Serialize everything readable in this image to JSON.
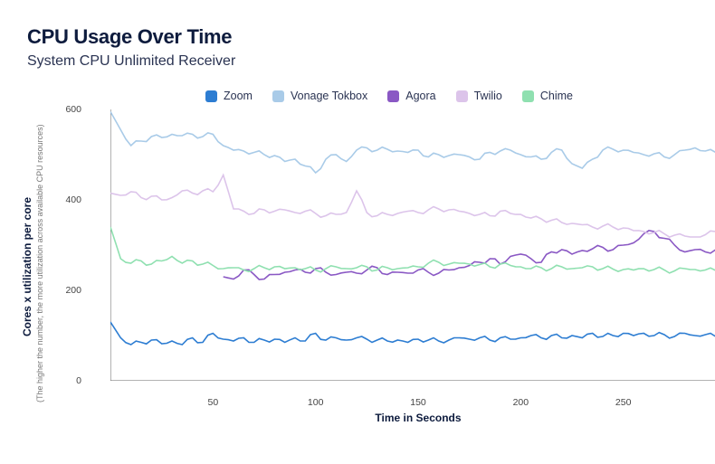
{
  "title": "CPU Usage Over Time",
  "subtitle": "System CPU Unlimited Receiver",
  "xlabel": "Time in Seconds",
  "ylabel": "Cores x utilization per core",
  "ylabel_sub": "(The higher the number, the more utilization across available CPU resources)",
  "legend": [
    {
      "name": "Zoom",
      "color": "#2d7dd2"
    },
    {
      "name": "Vonage Tokbox",
      "color": "#a9cbe8"
    },
    {
      "name": "Agora",
      "color": "#8a58c4"
    },
    {
      "name": "Twilio",
      "color": "#dcc4ea"
    },
    {
      "name": "Chime",
      "color": "#8fe0b0"
    }
  ],
  "chart_data": {
    "type": "line",
    "xlabel": "Time in Seconds",
    "ylabel": "Cores x utilization per core",
    "title": "CPU Usage Over Time — System CPU Unlimited Receiver",
    "xlim": [
      0,
      300
    ],
    "ylim": [
      0,
      600
    ],
    "xticks": [
      50,
      100,
      150,
      200,
      250,
      300
    ],
    "yticks": [
      0,
      200,
      400,
      600
    ],
    "x": [
      0,
      5,
      10,
      15,
      20,
      25,
      30,
      35,
      40,
      45,
      50,
      55,
      60,
      65,
      70,
      75,
      80,
      85,
      90,
      95,
      100,
      105,
      110,
      115,
      120,
      125,
      130,
      135,
      140,
      145,
      150,
      155,
      160,
      165,
      170,
      175,
      180,
      185,
      190,
      195,
      200,
      205,
      210,
      215,
      220,
      225,
      230,
      235,
      240,
      245,
      250,
      255,
      260,
      265,
      270,
      275,
      280,
      285,
      290,
      295,
      300
    ],
    "series": [
      {
        "name": "Zoom",
        "color": "#2d7dd2",
        "values": [
          130,
          95,
          80,
          85,
          90,
          82,
          88,
          80,
          95,
          85,
          105,
          92,
          88,
          95,
          85,
          90,
          92,
          85,
          95,
          88,
          105,
          90,
          95,
          90,
          95,
          92,
          90,
          88,
          90,
          85,
          92,
          90,
          88,
          90,
          95,
          92,
          95,
          90,
          95,
          92,
          95,
          100,
          95,
          100,
          95,
          100,
          95,
          105,
          98,
          100,
          105,
          100,
          105,
          100,
          102,
          98,
          105,
          100,
          102,
          98,
          105
        ]
      },
      {
        "name": "Vonage Tokbox",
        "color": "#a9cbe8",
        "values": [
          595,
          555,
          520,
          530,
          540,
          538,
          545,
          542,
          545,
          540,
          545,
          520,
          510,
          508,
          505,
          500,
          498,
          485,
          490,
          475,
          460,
          490,
          500,
          485,
          510,
          515,
          510,
          512,
          508,
          505,
          510,
          495,
          500,
          498,
          500,
          495,
          490,
          505,
          508,
          510,
          500,
          495,
          490,
          505,
          510,
          480,
          470,
          490,
          510,
          512,
          510,
          505,
          500,
          502,
          495,
          500,
          510,
          515,
          508,
          505,
          510
        ]
      },
      {
        "name": "Agora",
        "color": "#8a58c4",
        "x_start": 55,
        "values": [
          230,
          225,
          245,
          235,
          225,
          235,
          240,
          245,
          240,
          248,
          240,
          235,
          240,
          238,
          245,
          250,
          235,
          240,
          238,
          245,
          240,
          238,
          245,
          250,
          255,
          262,
          270,
          258,
          275,
          280,
          270,
          262,
          285,
          290,
          280,
          288,
          292,
          295,
          290,
          300,
          305,
          325,
          330,
          315,
          300,
          285,
          290,
          285,
          290,
          300
        ]
      },
      {
        "name": "Twilio",
        "color": "#dcc4ea",
        "values": [
          415,
          410,
          418,
          405,
          408,
          400,
          405,
          420,
          415,
          420,
          418,
          455,
          380,
          375,
          370,
          378,
          375,
          378,
          372,
          375,
          370,
          365,
          368,
          372,
          420,
          372,
          365,
          368,
          370,
          375,
          372,
          378,
          380,
          378,
          375,
          370,
          368,
          365,
          375,
          370,
          368,
          360,
          358,
          355,
          350,
          348,
          345,
          340,
          342,
          340,
          338,
          332,
          330,
          328,
          325,
          322,
          320,
          318,
          323,
          330,
          325
        ]
      },
      {
        "name": "Chime",
        "color": "#8fe0b0",
        "values": [
          340,
          270,
          260,
          265,
          258,
          265,
          275,
          260,
          265,
          258,
          255,
          248,
          250,
          245,
          248,
          250,
          252,
          248,
          250,
          248,
          245,
          248,
          252,
          248,
          250,
          252,
          245,
          250,
          248,
          250,
          252,
          260,
          262,
          258,
          260,
          258,
          257,
          252,
          258,
          255,
          252,
          248,
          250,
          248,
          252,
          248,
          250,
          252,
          248,
          247,
          246,
          245,
          248,
          246,
          245,
          243,
          248,
          246,
          245,
          244,
          248
        ]
      }
    ]
  }
}
